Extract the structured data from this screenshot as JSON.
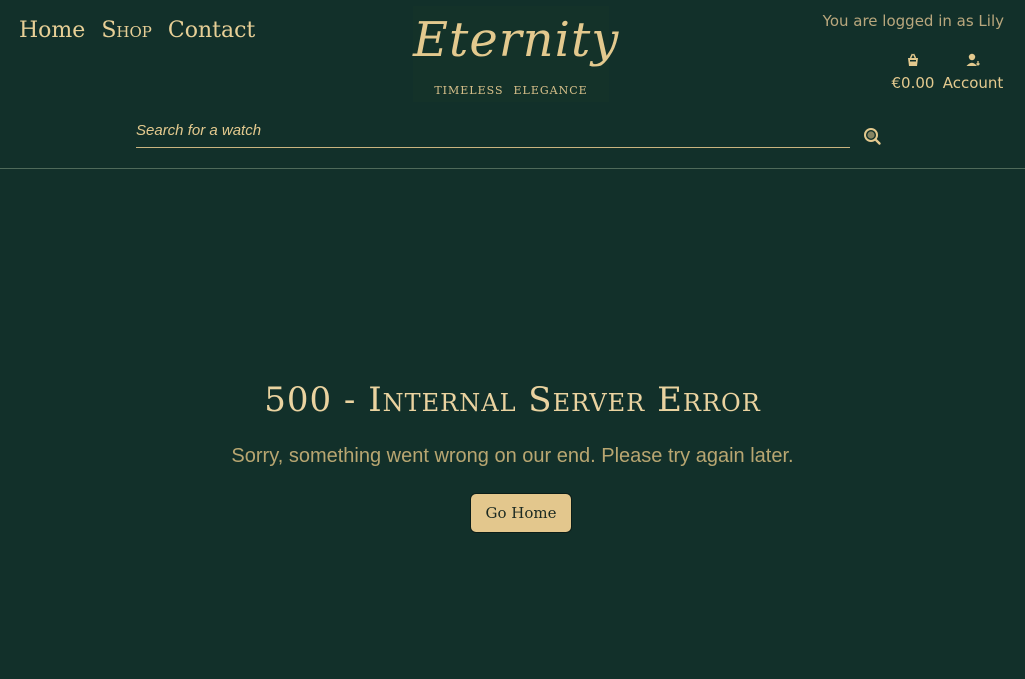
{
  "nav": {
    "home_label": "Home",
    "shop_label": "Shop",
    "contact_label": "Contact"
  },
  "logo": {
    "title": "Eternity",
    "tagline_word1": "TIMELESS",
    "tagline_word2": "ELEGANCE"
  },
  "user": {
    "logged_in_text": "You are logged in as Lily"
  },
  "cart": {
    "amount": "€0.00",
    "icon": "basket-icon"
  },
  "account": {
    "label": "Account",
    "icon": "account-icon"
  },
  "search": {
    "placeholder": "Search for a watch",
    "icon": "search-icon"
  },
  "error": {
    "title": "500 - Internal Server Error",
    "message": "Sorry, something went wrong on our end. Please try again later.",
    "button_label": "Go Home"
  },
  "colors": {
    "background": "#12302a",
    "accent_gold": "#e3c98e",
    "button_fill": "#e3c78d",
    "muted_text": "#b8a671"
  }
}
